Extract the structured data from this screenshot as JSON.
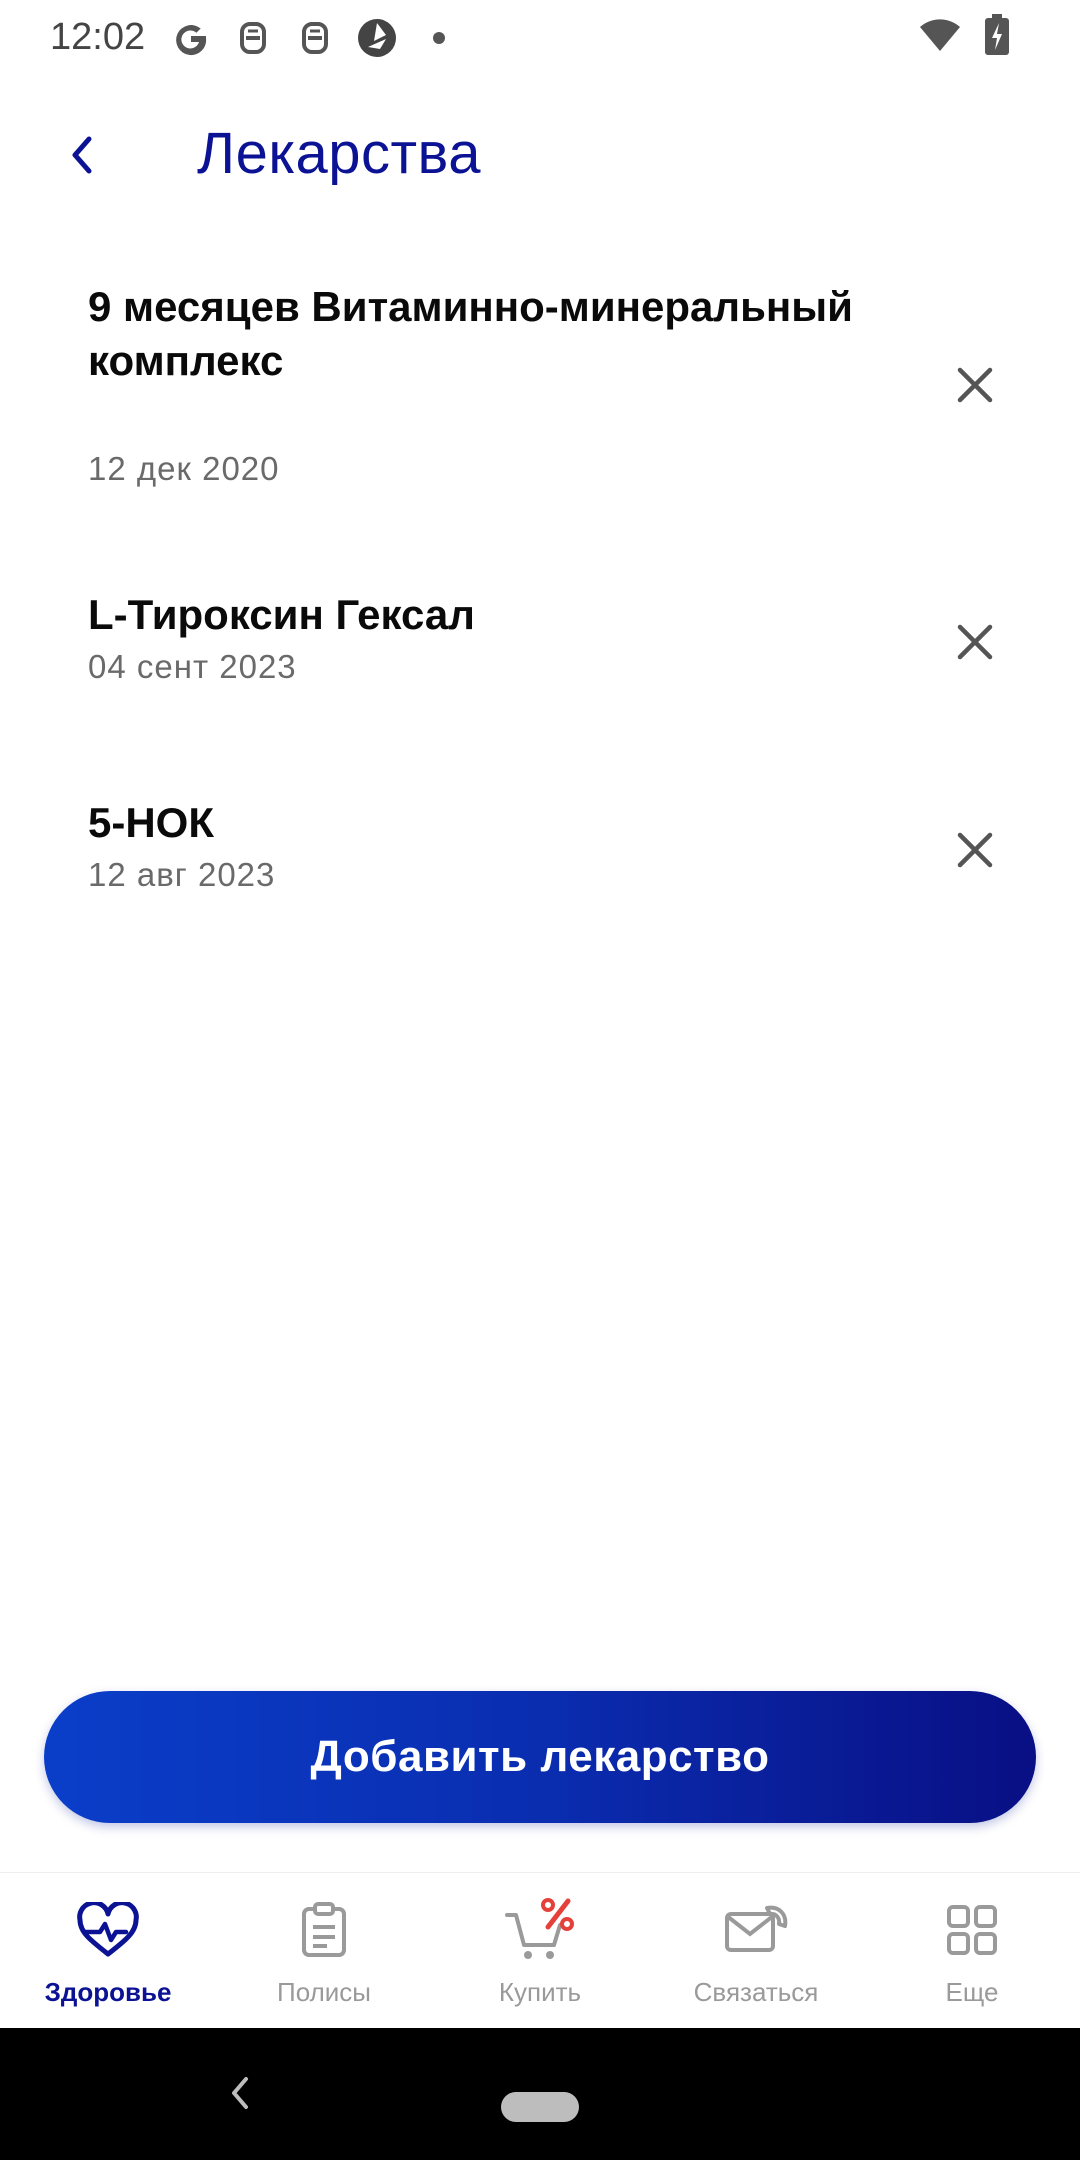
{
  "status_bar": {
    "time": "12:02",
    "icons_left": [
      "google-g-icon",
      "notification-robot-icon",
      "notification-robot-icon",
      "app-aperture-icon",
      "dot-icon"
    ],
    "icons_right": [
      "wifi-icon",
      "battery-charging-icon"
    ]
  },
  "header": {
    "title": "Лекарства",
    "back_icon": "chevron-left-icon"
  },
  "medications": [
    {
      "name": "9 месяцев Витаминно-минеральный комплекс",
      "date": "12 дек 2020"
    },
    {
      "name": "L-Тироксин Гексал",
      "date": "04 сент 2023"
    },
    {
      "name": "5-НОК",
      "date": "12 авг 2023"
    }
  ],
  "add_button": {
    "label": "Добавить лекарство"
  },
  "bottom_nav": {
    "items": [
      {
        "label": "Здоровье",
        "icon": "heart-pulse-icon",
        "active": true
      },
      {
        "label": "Полисы",
        "icon": "clipboard-icon",
        "active": false
      },
      {
        "label": "Купить",
        "icon": "cart-discount-icon",
        "active": false
      },
      {
        "label": "Связаться",
        "icon": "mail-phone-icon",
        "active": false
      },
      {
        "label": "Еще",
        "icon": "grid-icon",
        "active": false
      }
    ]
  },
  "colors": {
    "accent": "#0b1394",
    "button_gradient_start": "#0a3ec9",
    "button_gradient_end": "#090f84",
    "discount_red": "#e5413a",
    "inactive": "#9a9a9a"
  }
}
